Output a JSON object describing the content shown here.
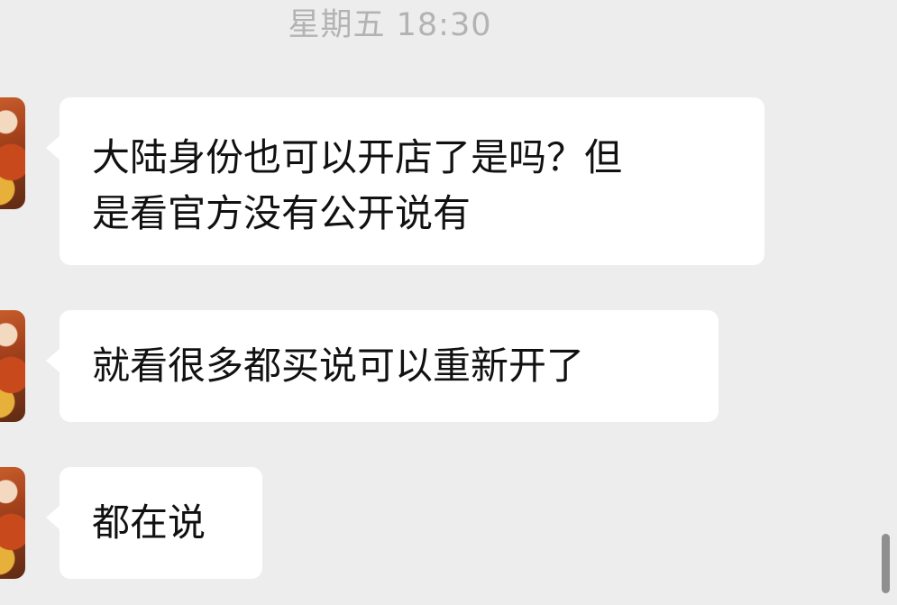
{
  "chat": {
    "timestamp": "星期五 18:30",
    "messages": [
      {
        "text": "大陆身份也可以开店了是吗？但\n是看官方没有公开说有"
      },
      {
        "text": "就看很多都买说可以重新开了"
      },
      {
        "text": "都在说"
      }
    ]
  }
}
